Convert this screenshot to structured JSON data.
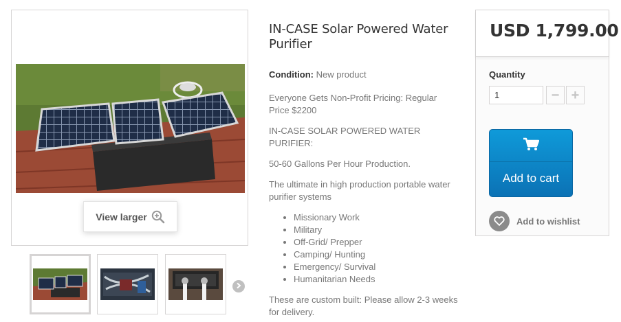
{
  "gallery": {
    "view_larger_label": "View larger",
    "thumbnails": [
      {
        "icon": "solar-purifier-thumb"
      },
      {
        "icon": "purifier-internals-thumb"
      },
      {
        "icon": "purifier-hoses-thumb"
      }
    ]
  },
  "product": {
    "title": "IN-CASE Solar Powered Water Purifier",
    "condition_label": "Condition:",
    "condition_value": "New product",
    "paragraphs": [
      "Everyone Gets Non-Profit Pricing: Regular Price $2200",
      "IN-CASE SOLAR POWERED WATER PURIFIER:",
      "50-60 Gallons Per Hour Production.",
      "The ultimate in high production portable water purifier systems"
    ],
    "uses": [
      "Missionary Work",
      "Military",
      "Off-Grid/ Prepper",
      "Camping/ Hunting",
      "Emergency/ Survival",
      "Humanitarian Needs"
    ],
    "footer_note": "These are custom built: Please allow 2-3 weeks for delivery."
  },
  "buybox": {
    "price": "USD 1,799.00",
    "quantity_label": "Quantity",
    "quantity_value": "1",
    "minus_label": "−",
    "plus_label": "+",
    "add_to_cart_label": "Add to cart",
    "wishlist_label": "Add to wishlist"
  },
  "colors": {
    "cart_button": "#0b72b5",
    "accent_grey": "#d6d4d4"
  }
}
